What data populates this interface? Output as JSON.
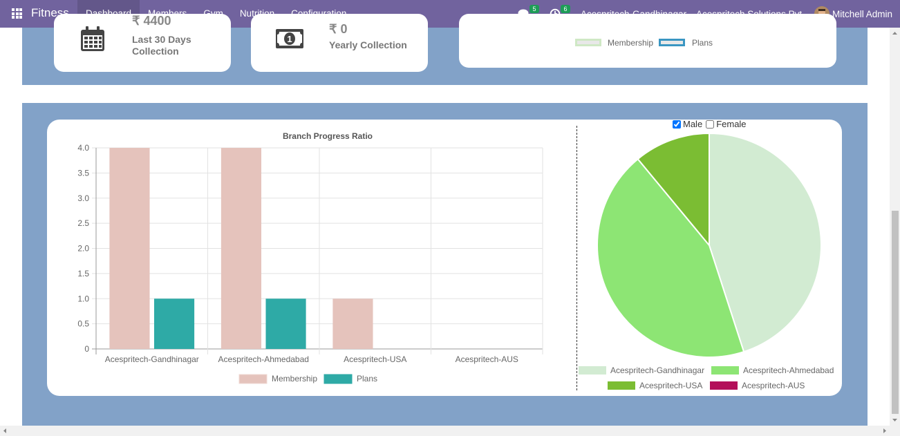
{
  "navbar": {
    "brand": "Fitness",
    "menu": [
      "Dashboard",
      "Members",
      "Gym",
      "Nutrition",
      "Configuration"
    ],
    "messages_count": "5",
    "activities_count": "6",
    "branch": "Acespritech-Gandhinagar",
    "company": "Acespritech Solutions Pvt",
    "user": "Mitchell Admin"
  },
  "stats": {
    "last30_value": "₹ 4400",
    "last30_title_1": "Last 30 Days",
    "last30_title_2": "Collection",
    "yearly_value": "₹ 0",
    "yearly_title": "Yearly Collection"
  },
  "top_legend": {
    "membership": "Membership",
    "plans": "Plans"
  },
  "gender_filter": {
    "male": "Male",
    "female": "Female",
    "male_checked": true,
    "female_checked": false
  },
  "colors": {
    "membership": "#e5c3bc",
    "plans": "#2eaaa6",
    "gandhinagar": "#d2ebd2",
    "ahmedabad": "#8de574",
    "usa": "#7bbd33",
    "aus": "#b3105a"
  },
  "chart_data": [
    {
      "type": "bar",
      "title": "Branch Progress Ratio",
      "categories": [
        "Acespritech-Gandhinagar",
        "Acespritech-Ahmedabad",
        "Acespritech-USA",
        "Acespritech-AUS"
      ],
      "series": [
        {
          "name": "Membership",
          "values": [
            4,
            4,
            1,
            0
          ]
        },
        {
          "name": "Plans",
          "values": [
            1,
            1,
            0,
            0
          ]
        }
      ],
      "ylim": [
        0,
        4
      ],
      "yticks": [
        "0",
        "0.5",
        "1.0",
        "1.5",
        "2.0",
        "2.5",
        "3.0",
        "3.5",
        "4.0"
      ],
      "legend": "bottom"
    },
    {
      "type": "pie",
      "labels": [
        "Acespritech-Gandhinagar",
        "Acespritech-Ahmedabad",
        "Acespritech-USA",
        "Acespritech-AUS"
      ],
      "values": [
        45,
        44,
        11,
        0
      ],
      "legend": "bottom"
    }
  ]
}
